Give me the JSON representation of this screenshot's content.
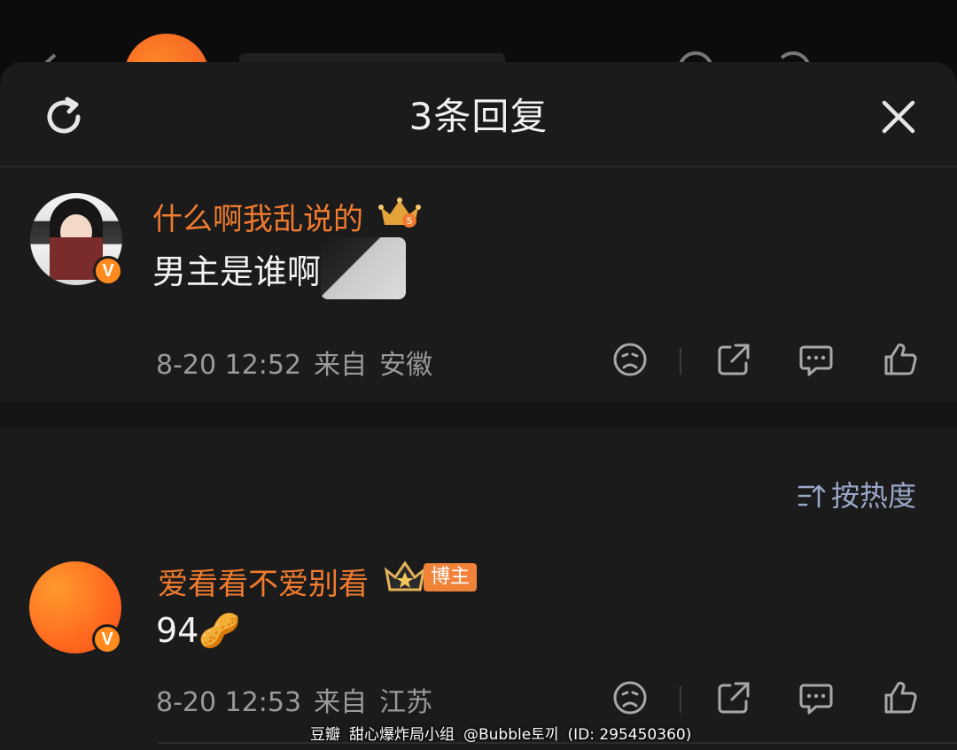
{
  "sheet": {
    "title": "3条回复",
    "refresh_icon": "refresh-icon",
    "close_icon": "close-icon"
  },
  "comments": [
    {
      "username": "什么啊我乱说的",
      "badge_icon": "crown-level-icon",
      "verified_badge": "V",
      "text": "男主是谁啊",
      "time": "8-20 12:52",
      "source_prefix": "来自",
      "location": "安徽"
    },
    {
      "username": "爱看看不爱别看",
      "badge_icon": "crown-level-icon",
      "role_badge": "博主",
      "verified_badge": "V",
      "text": "94🥜",
      "time": "8-20 12:53",
      "source_prefix": "来自",
      "location": "江苏"
    }
  ],
  "sort": {
    "label": "按热度",
    "icon": "sort-icon"
  },
  "actions": [
    "dislike-icon",
    "share-icon",
    "comment-icon",
    "like-icon"
  ],
  "watermark": {
    "site": "豆瓣",
    "group": "甜心爆炸局小组",
    "user": "@Bubble토끼",
    "id": "(ID: 295450360)"
  },
  "colors": {
    "username": "#f07b2f",
    "accent_badge": "#ff8a1e",
    "sort": "#9aa7c8"
  }
}
